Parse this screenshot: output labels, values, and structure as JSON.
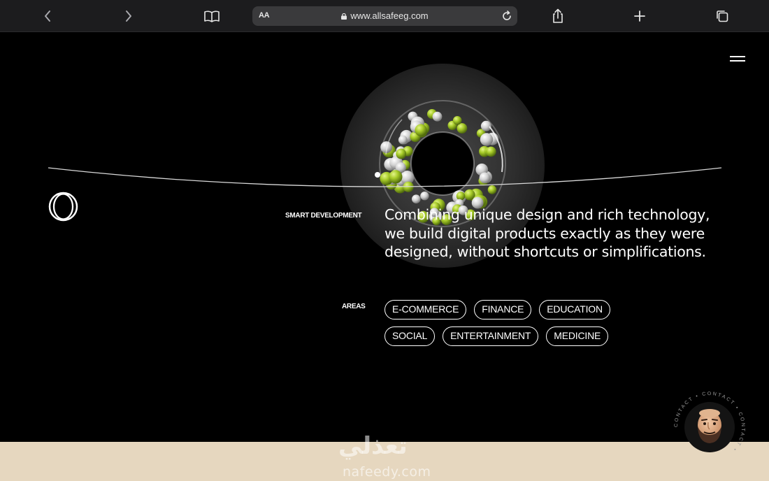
{
  "browser": {
    "url": "www.allsafeeg.com",
    "reader_label": "AA"
  },
  "hero": {
    "eyebrow": "SMART DEVELOPMENT",
    "headline": "Combining unique design and rich technology, we build digital products exactly as they were designed, without shortcuts or simplifications.",
    "areas_label": "AREAS",
    "areas": [
      "E-COMMERCE",
      "FINANCE",
      "EDUCATION",
      "SOCIAL",
      "ENTERTAINMENT",
      "MEDICINE"
    ]
  },
  "contact": {
    "ring_text": "CONTACT • CONTACT • CONTACT • "
  },
  "watermark": {
    "arabic": "تعذلي",
    "latin": "nafeedy.com"
  },
  "colors": {
    "toolbar_bg": "#1c1c1e",
    "urlbar_bg": "#3a3a3c",
    "page_bg": "#000000",
    "accent_green": "#a8cc2a",
    "watermark_bg": "#e6d7bf"
  },
  "icons": [
    "chevron-left-icon",
    "chevron-right-icon",
    "book-icon",
    "lock-icon",
    "reload-icon",
    "share-icon",
    "plus-icon",
    "tabs-icon",
    "menu-icon"
  ]
}
